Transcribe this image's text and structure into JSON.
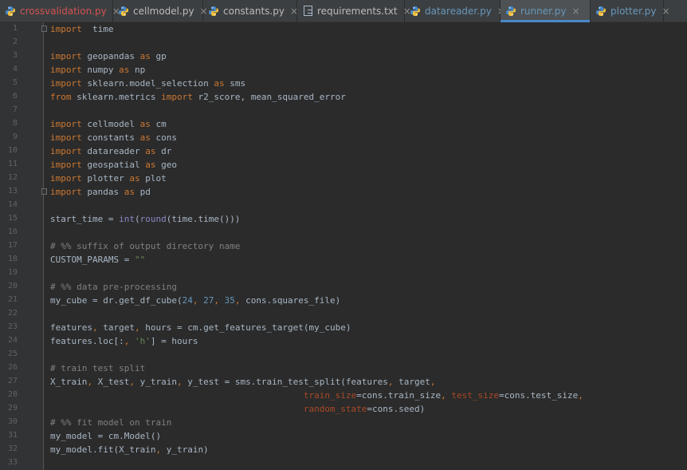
{
  "tabs": [
    {
      "label": "crossvalidation.py",
      "color": "#d25252",
      "icon": "python-file-icon",
      "active": false
    },
    {
      "label": "cellmodel.py",
      "color": "#bbbbbb",
      "icon": "python-file-icon",
      "active": false
    },
    {
      "label": "constants.py",
      "color": "#bbbbbb",
      "icon": "python-file-icon",
      "active": false
    },
    {
      "label": "requirements.txt",
      "color": "#bbbbbb",
      "icon": "text-file-icon",
      "active": false
    },
    {
      "label": "datareader.py",
      "color": "#6897bb",
      "icon": "python-file-icon",
      "active": false
    },
    {
      "label": "runner.py",
      "color": "#6897bb",
      "icon": "python-file-icon",
      "active": true
    },
    {
      "label": "plotter.py",
      "color": "#6897bb",
      "icon": "python-file-icon",
      "active": false
    }
  ],
  "close_glyph": "×",
  "colors": {
    "keyword": "#cc7832",
    "number": "#6897bb",
    "string": "#6a8759",
    "comment": "#808080",
    "builtin": "#8888c6",
    "param": "#aa4926",
    "text": "#a9b7c6",
    "background": "#2b2b2b"
  },
  "lines": [
    {
      "n": "1",
      "fold": true,
      "t": [
        [
          "kw",
          "import"
        ],
        [
          "",
          "  time"
        ]
      ]
    },
    {
      "n": "2",
      "t": []
    },
    {
      "n": "3",
      "t": [
        [
          "kw",
          "import"
        ],
        [
          "",
          " geopandas "
        ],
        [
          "kw",
          "as"
        ],
        [
          "",
          " gp"
        ]
      ]
    },
    {
      "n": "4",
      "t": [
        [
          "kw",
          "import"
        ],
        [
          "",
          " numpy "
        ],
        [
          "kw",
          "as"
        ],
        [
          "",
          " np"
        ]
      ]
    },
    {
      "n": "5",
      "t": [
        [
          "kw",
          "import"
        ],
        [
          "",
          " sklearn.model_selection "
        ],
        [
          "kw",
          "as"
        ],
        [
          "",
          " sms"
        ]
      ]
    },
    {
      "n": "6",
      "t": [
        [
          "kw",
          "from"
        ],
        [
          "",
          " sklearn.metrics "
        ],
        [
          "kw",
          "import"
        ],
        [
          "",
          " r2_score, mean_squared_error"
        ]
      ]
    },
    {
      "n": "7",
      "t": []
    },
    {
      "n": "8",
      "t": [
        [
          "kw",
          "import"
        ],
        [
          "",
          " cellmodel "
        ],
        [
          "kw",
          "as"
        ],
        [
          "",
          " cm"
        ]
      ]
    },
    {
      "n": "9",
      "t": [
        [
          "kw",
          "import"
        ],
        [
          "",
          " constants "
        ],
        [
          "kw",
          "as"
        ],
        [
          "",
          " cons"
        ]
      ]
    },
    {
      "n": "10",
      "t": [
        [
          "kw",
          "import"
        ],
        [
          "",
          " datareader "
        ],
        [
          "kw",
          "as"
        ],
        [
          "",
          " dr"
        ]
      ]
    },
    {
      "n": "11",
      "t": [
        [
          "kw",
          "import"
        ],
        [
          "",
          " geospatial "
        ],
        [
          "kw",
          "as"
        ],
        [
          "",
          " geo"
        ]
      ]
    },
    {
      "n": "12",
      "t": [
        [
          "kw",
          "import"
        ],
        [
          "",
          " plotter "
        ],
        [
          "kw",
          "as"
        ],
        [
          "",
          " plot"
        ]
      ]
    },
    {
      "n": "13",
      "fold": true,
      "t": [
        [
          "kw",
          "import"
        ],
        [
          "",
          " pandas "
        ],
        [
          "kw",
          "as"
        ],
        [
          "",
          " pd"
        ]
      ]
    },
    {
      "n": "14",
      "t": []
    },
    {
      "n": "15",
      "t": [
        [
          "",
          "start_time = "
        ],
        [
          "bi",
          "int"
        ],
        [
          "",
          "("
        ],
        [
          "bi",
          "round"
        ],
        [
          "",
          "(time.time()))"
        ]
      ]
    },
    {
      "n": "16",
      "t": []
    },
    {
      "n": "17",
      "t": [
        [
          "cmt",
          "# %% suffix of output directory name"
        ]
      ]
    },
    {
      "n": "18",
      "t": [
        [
          "",
          "CUSTOM_PARAMS = "
        ],
        [
          "str",
          "\"\""
        ]
      ]
    },
    {
      "n": "19",
      "t": []
    },
    {
      "n": "20",
      "t": [
        [
          "cmt",
          "# %% data pre-processing"
        ]
      ]
    },
    {
      "n": "21",
      "t": [
        [
          "",
          "my_cube = dr.get_df_cube("
        ],
        [
          "num",
          "24"
        ],
        [
          "kw",
          ", "
        ],
        [
          "num",
          "27"
        ],
        [
          "kw",
          ", "
        ],
        [
          "num",
          "35"
        ],
        [
          "kw",
          ", "
        ],
        [
          "",
          "cons.squares_file)"
        ]
      ]
    },
    {
      "n": "22",
      "t": []
    },
    {
      "n": "23",
      "t": [
        [
          "",
          "features"
        ],
        [
          "kw",
          ", "
        ],
        [
          "",
          "target"
        ],
        [
          "kw",
          ", "
        ],
        [
          "",
          "hours = cm.get_features_target(my_cube)"
        ]
      ]
    },
    {
      "n": "24",
      "t": [
        [
          "",
          "features.loc[:"
        ],
        [
          "kw",
          ", "
        ],
        [
          "str",
          "'h'"
        ],
        [
          "",
          "] = hours"
        ]
      ]
    },
    {
      "n": "25",
      "t": []
    },
    {
      "n": "26",
      "t": [
        [
          "cmt",
          "# train test split"
        ]
      ]
    },
    {
      "n": "27",
      "t": [
        [
          "",
          "X_train"
        ],
        [
          "kw",
          ", "
        ],
        [
          "",
          "X_test"
        ],
        [
          "kw",
          ", "
        ],
        [
          "",
          "y_train"
        ],
        [
          "kw",
          ", "
        ],
        [
          "",
          "y_test = sms.train_test_split(features"
        ],
        [
          "kw",
          ", "
        ],
        [
          "",
          "target"
        ],
        [
          "kw",
          ","
        ]
      ]
    },
    {
      "n": "28",
      "t": [
        [
          "",
          "                                                "
        ],
        [
          "par",
          "train_size"
        ],
        [
          "",
          "=cons.train_size"
        ],
        [
          "kw",
          ", "
        ],
        [
          "par",
          "test_size"
        ],
        [
          "",
          "=cons.test_size"
        ],
        [
          "kw",
          ","
        ]
      ]
    },
    {
      "n": "29",
      "t": [
        [
          "",
          "                                                "
        ],
        [
          "par",
          "random_state"
        ],
        [
          "",
          "=cons.seed)"
        ]
      ]
    },
    {
      "n": "30",
      "t": [
        [
          "cmt",
          "# %% fit model on train"
        ]
      ]
    },
    {
      "n": "31",
      "t": [
        [
          "",
          "my_model = cm.Model()"
        ]
      ]
    },
    {
      "n": "32",
      "t": [
        [
          "",
          "my_model.fit(X_train"
        ],
        [
          "kw",
          ", "
        ],
        [
          "",
          "y_train)"
        ]
      ]
    },
    {
      "n": "33",
      "t": []
    }
  ]
}
